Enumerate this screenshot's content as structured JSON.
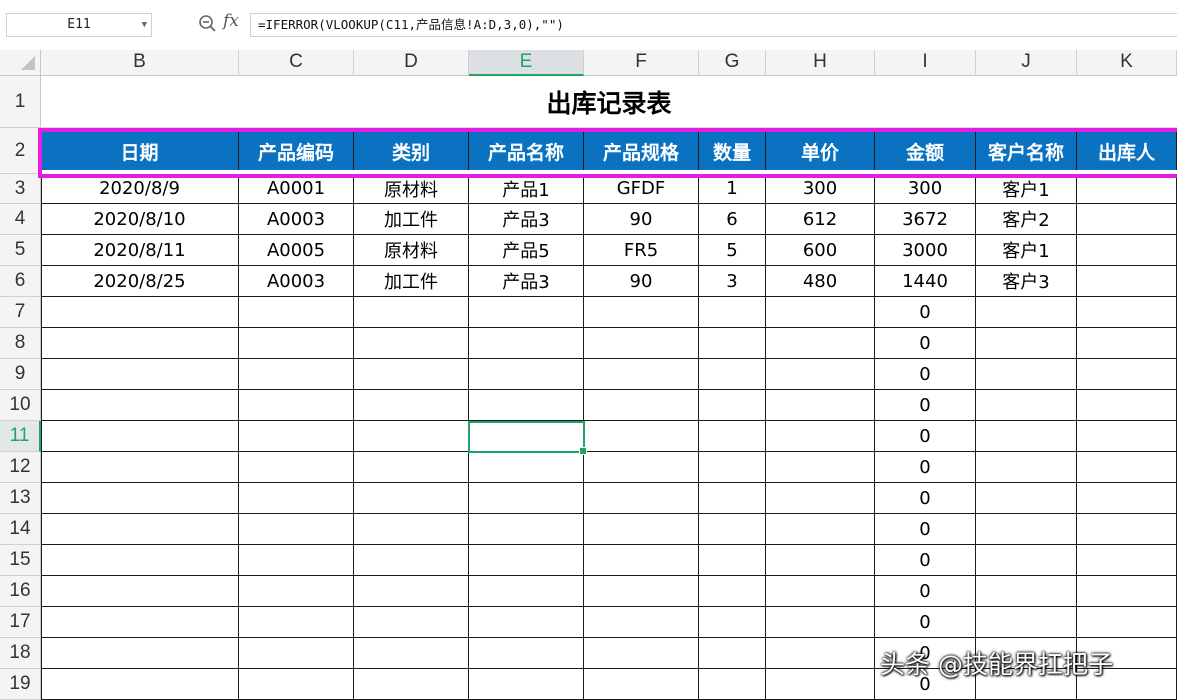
{
  "formula_bar": {
    "name_box": "E11",
    "fx_label": "fx",
    "formula": "=IFERROR(VLOOKUP(C11,产品信息!A:D,3,0),\"\")"
  },
  "columns": [
    "B",
    "C",
    "D",
    "E",
    "F",
    "G",
    "H",
    "I",
    "J",
    "K"
  ],
  "active_column": "E",
  "rows": [
    "1",
    "2",
    "3",
    "4",
    "5",
    "6",
    "7",
    "8",
    "9",
    "10",
    "11",
    "12",
    "13",
    "14",
    "15",
    "16",
    "17",
    "18",
    "19"
  ],
  "active_row": "11",
  "sheet": {
    "title": "出库记录表",
    "headers": [
      "日期",
      "产品编码",
      "类别",
      "产品名称",
      "产品规格",
      "数量",
      "单价",
      "金额",
      "客户名称",
      "出库人"
    ],
    "data_rows": [
      [
        "2020/8/9",
        "A0001",
        "原材料",
        "产品1",
        "GFDF",
        "1",
        "300",
        "300",
        "客户1",
        ""
      ],
      [
        "2020/8/10",
        "A0003",
        "加工件",
        "产品3",
        "90",
        "6",
        "612",
        "3672",
        "客户2",
        ""
      ],
      [
        "2020/8/11",
        "A0005",
        "原材料",
        "产品5",
        "FR5",
        "5",
        "600",
        "3000",
        "客户1",
        ""
      ],
      [
        "2020/8/25",
        "A0003",
        "加工件",
        "产品3",
        "90",
        "3",
        "480",
        "1440",
        "客户3",
        ""
      ],
      [
        "",
        "",
        "",
        "",
        "",
        "",
        "",
        "0",
        "",
        ""
      ],
      [
        "",
        "",
        "",
        "",
        "",
        "",
        "",
        "0",
        "",
        ""
      ],
      [
        "",
        "",
        "",
        "",
        "",
        "",
        "",
        "0",
        "",
        ""
      ],
      [
        "",
        "",
        "",
        "",
        "",
        "",
        "",
        "0",
        "",
        ""
      ],
      [
        "",
        "",
        "",
        "",
        "",
        "",
        "",
        "0",
        "",
        ""
      ],
      [
        "",
        "",
        "",
        "",
        "",
        "",
        "",
        "0",
        "",
        ""
      ],
      [
        "",
        "",
        "",
        "",
        "",
        "",
        "",
        "0",
        "",
        ""
      ],
      [
        "",
        "",
        "",
        "",
        "",
        "",
        "",
        "0",
        "",
        ""
      ],
      [
        "",
        "",
        "",
        "",
        "",
        "",
        "",
        "0",
        "",
        ""
      ],
      [
        "",
        "",
        "",
        "",
        "",
        "",
        "",
        "0",
        "",
        ""
      ],
      [
        "",
        "",
        "",
        "",
        "",
        "",
        "",
        "0",
        "",
        ""
      ],
      [
        "",
        "",
        "",
        "",
        "",
        "",
        "",
        "0",
        "",
        ""
      ],
      [
        "",
        "",
        "",
        "",
        "",
        "",
        "",
        "0",
        "",
        ""
      ]
    ]
  },
  "colors": {
    "header_fill": "#0a72c0",
    "highlight": "#e51de2",
    "selection": "#21a366"
  },
  "watermark": "头条 @技能界扛把子"
}
